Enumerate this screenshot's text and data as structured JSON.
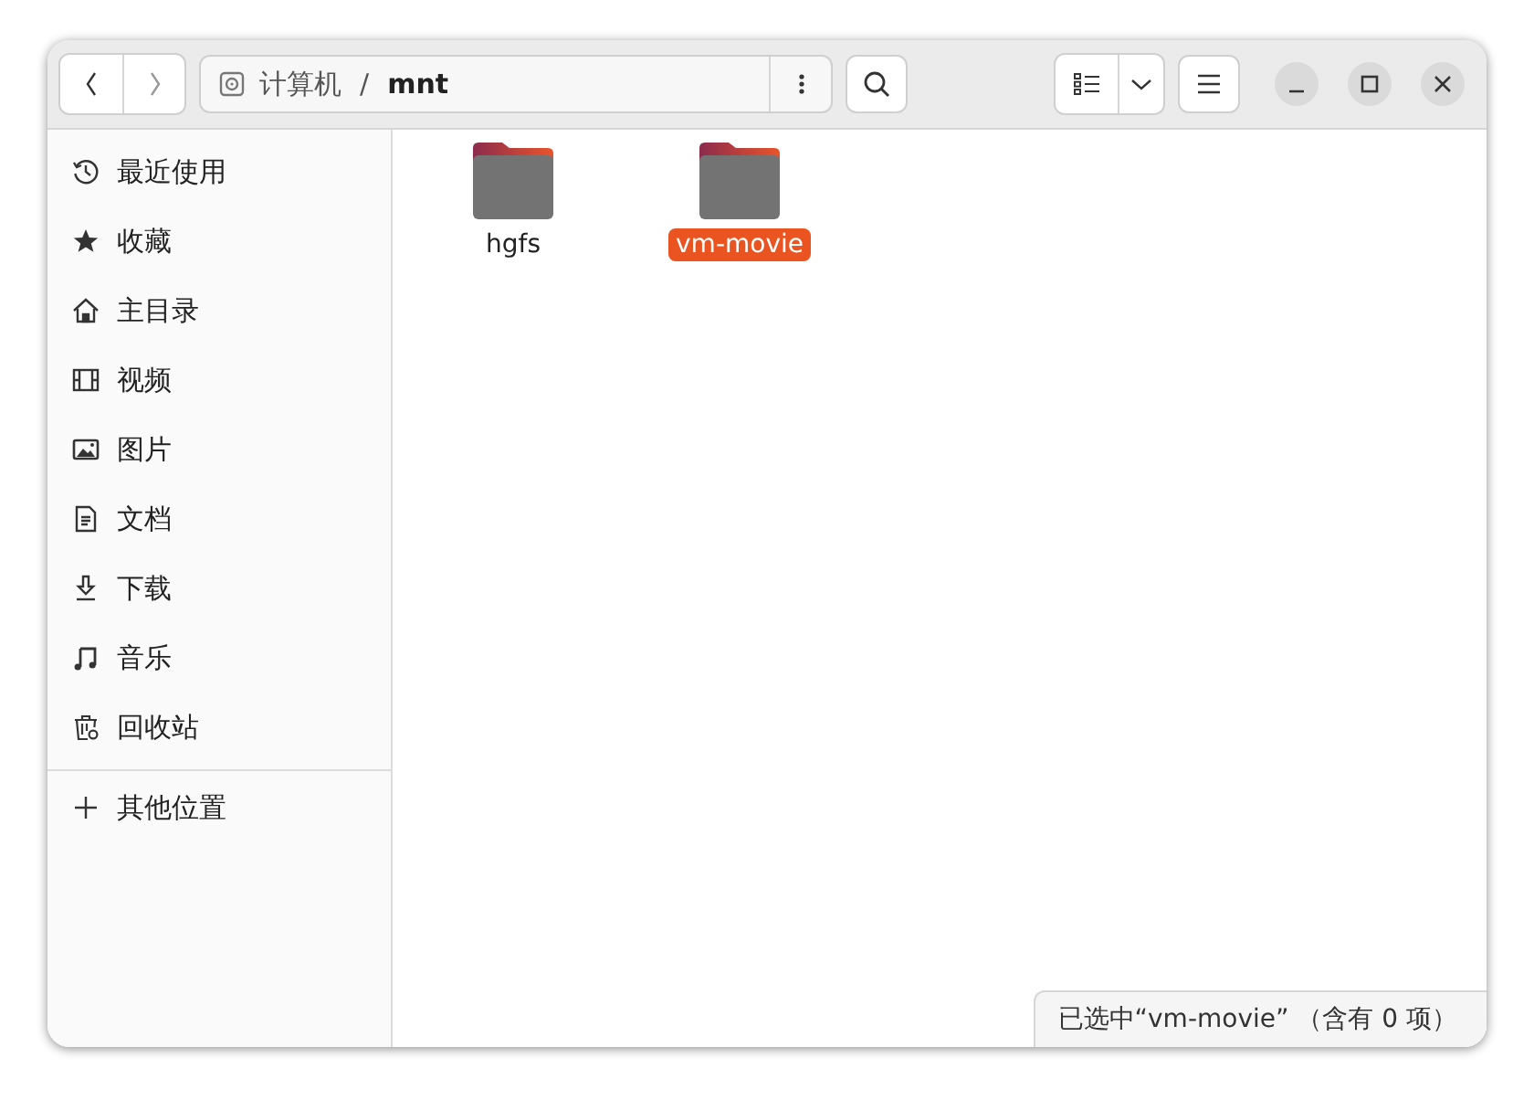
{
  "path": [
    {
      "label": "计算机",
      "current": false
    },
    {
      "label": "mnt",
      "current": true
    }
  ],
  "path_separator": "/",
  "sidebar": {
    "items": [
      {
        "kind": "recent",
        "label": "最近使用",
        "selected": false
      },
      {
        "kind": "starred",
        "label": "收藏",
        "selected": false
      },
      {
        "kind": "home",
        "label": "主目录",
        "selected": false
      },
      {
        "kind": "videos",
        "label": "视频",
        "selected": false
      },
      {
        "kind": "pictures",
        "label": "图片",
        "selected": false
      },
      {
        "kind": "documents",
        "label": "文档",
        "selected": false
      },
      {
        "kind": "downloads",
        "label": "下载",
        "selected": false
      },
      {
        "kind": "music",
        "label": "音乐",
        "selected": false
      },
      {
        "kind": "trash",
        "label": "回收站",
        "selected": false
      }
    ],
    "other": {
      "kind": "other",
      "label": "其他位置",
      "selected": false
    }
  },
  "files": [
    {
      "name": "hgfs",
      "selected": false
    },
    {
      "name": "vm-movie",
      "selected": true
    }
  ],
  "status_bar": "已选中“vm-movie” （含有 0 项）"
}
